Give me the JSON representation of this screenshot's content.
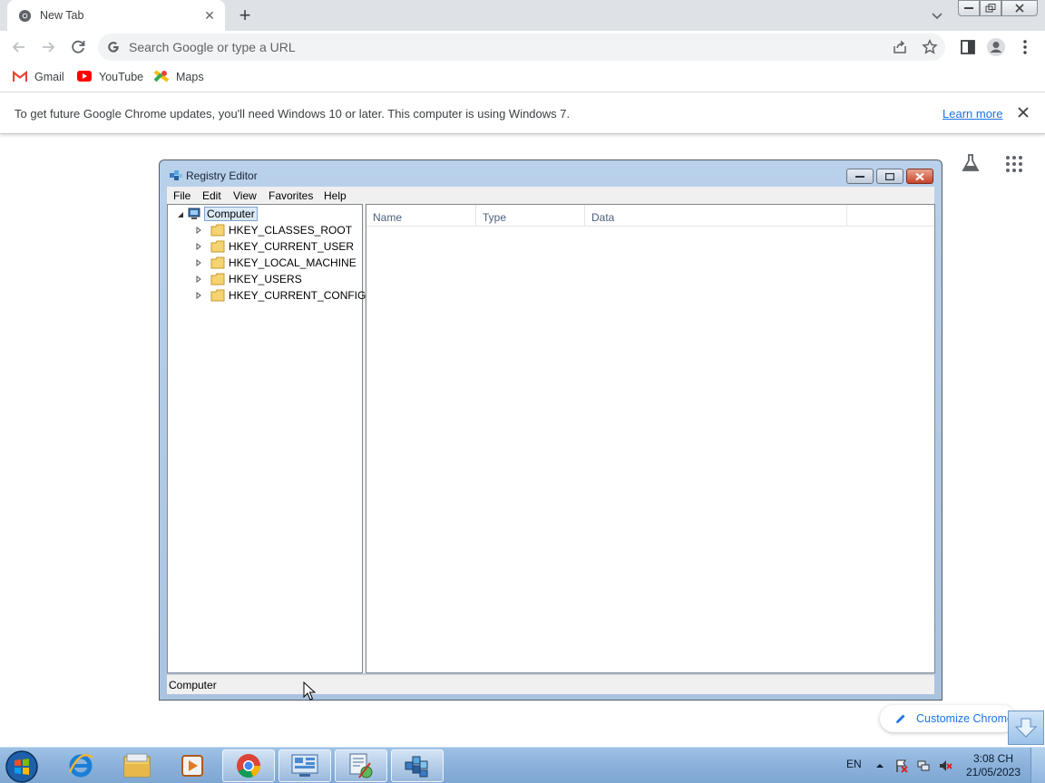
{
  "browser": {
    "tab": {
      "title": "New Tab",
      "icon": "chrome-icon",
      "close": "✕"
    },
    "new_tab": "+",
    "omnibox": {
      "placeholder": "Search Google or type a URL"
    },
    "bookmarks": [
      {
        "label": "Gmail",
        "icon": "gmail-icon"
      },
      {
        "label": "YouTube",
        "icon": "youtube-icon"
      },
      {
        "label": "Maps",
        "icon": "maps-icon"
      }
    ],
    "infobar": {
      "message": "To get future Google Chrome updates, you'll need Windows 10 or later. This computer is using Windows 7.",
      "link": "Learn more"
    },
    "customize_label": "Customize Chrome"
  },
  "regedit": {
    "title": "Registry Editor",
    "menu": [
      "File",
      "Edit",
      "View",
      "Favorites",
      "Help"
    ],
    "tree": {
      "root": "Computer",
      "keys": [
        "HKEY_CLASSES_ROOT",
        "HKEY_CURRENT_USER",
        "HKEY_LOCAL_MACHINE",
        "HKEY_USERS",
        "HKEY_CURRENT_CONFIG"
      ]
    },
    "columns": [
      "Name",
      "Type",
      "Data"
    ],
    "status": "Computer"
  },
  "taskbar": {
    "apps": [
      "internet-explorer-icon",
      "file-explorer-icon",
      "media-player-icon",
      "chrome-icon",
      "control-panel-icon",
      "network-tool-icon",
      "registry-editor-icon"
    ],
    "language": "EN",
    "time": "3:08 CH",
    "date": "21/05/2023"
  },
  "colors": {
    "chrome_tabstrip": "#dee1e6",
    "link_blue": "#1a73e8",
    "taskbar": "#8db3dc",
    "close_red": "#c8432a"
  }
}
